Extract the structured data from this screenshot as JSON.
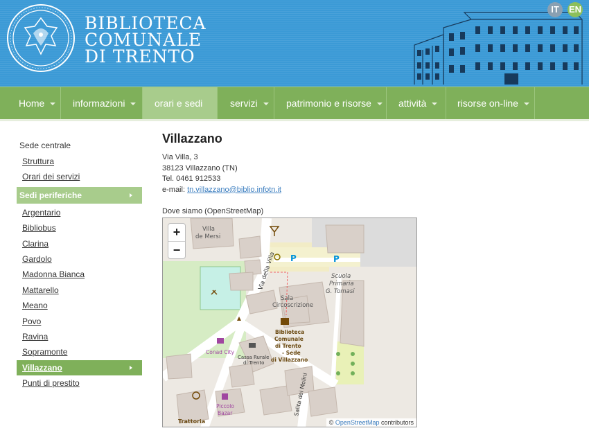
{
  "header": {
    "logo_line1": "BIBLIOTECA",
    "logo_line2": "COMUNALE",
    "logo_line3": "DI TRENTO",
    "lang_it": "IT",
    "lang_en": "EN"
  },
  "nav": {
    "home": "Home",
    "informazioni": "informazioni",
    "orari": "orari e sedi",
    "servizi": "servizi",
    "patrimonio": "patrimonio e risorse",
    "attivita": "attività",
    "risorse": "risorse on-line"
  },
  "sidebar": {
    "sede_centrale": "Sede centrale",
    "struttura": "Struttura",
    "orari_servizi": "Orari dei servizi",
    "sedi_periferiche": "Sedi periferiche",
    "items": [
      "Argentario",
      "Bibliobus",
      "Clarina",
      "Gardolo",
      "Madonna Bianca",
      "Mattarello",
      "Meano",
      "Povo",
      "Ravina",
      "Sopramonte"
    ],
    "current": "Villazzano",
    "punti": "Punti di prestito"
  },
  "main": {
    "title": "Villazzano",
    "address": "Via Villa, 3",
    "city": "38123 Villazzano (TN)",
    "tel": "Tel. 0461 912533",
    "email_label": "e-mail: ",
    "email": "tn.villazzano@biblio.infotn.it",
    "map_label": "Dove siamo (OpenStreetMap)"
  },
  "map": {
    "zoom_in": "+",
    "zoom_out": "−",
    "attribution_prefix": "© ",
    "attribution_link": "OpenStreetMap",
    "attribution_suffix": " contributors",
    "labels": {
      "villa1": "Villa",
      "villa2": "de Mersi",
      "street_villa": "Via della Villa",
      "sala1": "Sala",
      "sala2": "Circoscrizione",
      "scuola1": "Scuola",
      "scuola2": "Primaria",
      "scuola3": "G. Tomasi",
      "bib1": "Biblioteca",
      "bib2": "Comunale",
      "bib3": "di Trento",
      "bib4": "- Sede",
      "bib5": "di Villazzano",
      "conad": "Conad City",
      "cassa1": "Cassa Rurale",
      "cassa2": "di Trento",
      "piccolo1": "Piccolo",
      "piccolo2": "Bazar",
      "trattoria": "Trattoria",
      "salita": "Salita dei Molini",
      "parking": "P"
    }
  }
}
